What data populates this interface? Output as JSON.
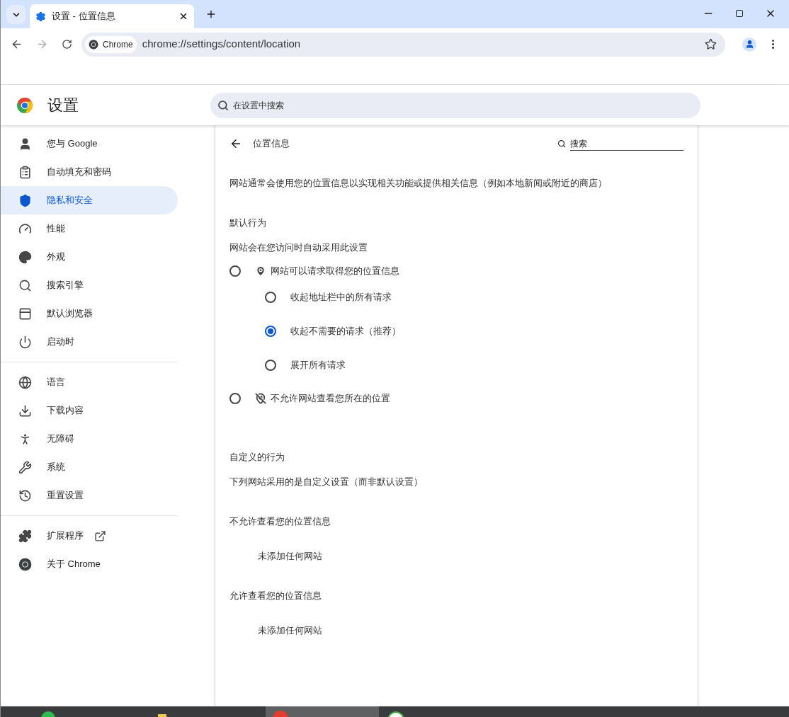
{
  "tab": {
    "title": "设置 - 位置信息"
  },
  "address_bar": {
    "chip": "Chrome",
    "url": "chrome://settings/content/location"
  },
  "header": {
    "title": "设置",
    "search": {
      "placeholder": "在设置中搜索"
    }
  },
  "sidebar": {
    "sections": [
      {
        "items": [
          {
            "label": "您与 Google",
            "selected": false,
            "external": false
          },
          {
            "label": "自动填充和密码",
            "selected": false,
            "external": false
          },
          {
            "label": "隐私和安全",
            "selected": true,
            "external": false
          },
          {
            "label": "性能",
            "selected": false,
            "external": false
          },
          {
            "label": "外观",
            "selected": false,
            "external": false
          },
          {
            "label": "搜索引擎",
            "selected": false,
            "external": false
          },
          {
            "label": "默认浏览器",
            "selected": false,
            "external": false
          },
          {
            "label": "启动时",
            "selected": false,
            "external": false
          }
        ]
      },
      {
        "items": [
          {
            "label": "语言",
            "selected": false,
            "external": false
          },
          {
            "label": "下载内容",
            "selected": false,
            "external": false
          },
          {
            "label": "无障碍",
            "selected": false,
            "external": false
          },
          {
            "label": "系统",
            "selected": false,
            "external": false
          },
          {
            "label": "重置设置",
            "selected": false,
            "external": false
          }
        ]
      },
      {
        "items": [
          {
            "label": "扩展程序",
            "selected": false,
            "external": true
          },
          {
            "label": "关于 Chrome",
            "selected": false,
            "external": false
          }
        ]
      }
    ]
  },
  "page": {
    "title": "位置信息",
    "search": {
      "placeholder": "搜索"
    },
    "description": "网站通常会使用您的位置信息以实现相关功能或提供相关信息（例如本地新闻或附近的商店）",
    "default_behavior": {
      "heading": "默认行为",
      "subtitle": "网站会在您访问时自动采用此设置",
      "options": [
        {
          "label": "网站可以请求取得您的位置信息",
          "selected": false,
          "children": [
            {
              "label": "收起地址栏中的所有请求",
              "selected": false
            },
            {
              "label": "收起不需要的请求（推荐）",
              "selected": true
            },
            {
              "label": "展开所有请求",
              "selected": false
            }
          ]
        },
        {
          "label": "不允许网站查看您所在的位置",
          "selected": false
        }
      ]
    },
    "custom_behavior": {
      "heading": "自定义的行为",
      "subtitle": "下列网站采用的是自定义设置（而非默认设置）",
      "lists": [
        {
          "heading": "不允许查看您的位置信息",
          "empty": "未添加任何网站"
        },
        {
          "heading": "允许查看您的位置信息",
          "empty": "未添加任何网站"
        }
      ]
    }
  }
}
